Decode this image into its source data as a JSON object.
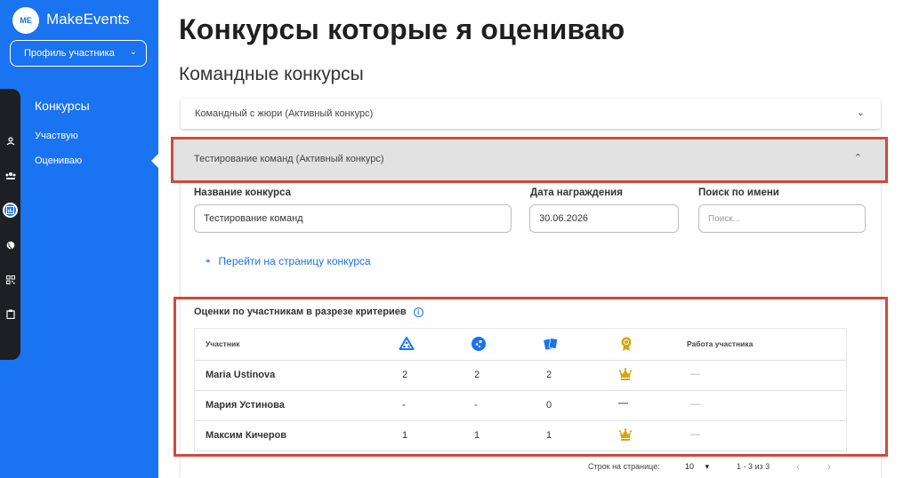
{
  "app": {
    "logo_badge": "ME",
    "logo_text": "MakeEvents"
  },
  "sidebar": {
    "profile_select": "Профиль участника",
    "section": "Конкурсы",
    "items": [
      {
        "label": "Участвую"
      },
      {
        "label": "Оцениваю"
      }
    ]
  },
  "page": {
    "title": "Конкурсы которые я оцениваю",
    "section_title": "Командные конкурсы"
  },
  "accordions": [
    {
      "label": "Командный с жюри (Активный конкурс)",
      "expanded": false
    },
    {
      "label": "Тестирование команд (Активный конкурс)",
      "expanded": true
    }
  ],
  "form": {
    "name_label": "Название конкурса",
    "name_value": "Тестирование команд",
    "date_label": "Дата награждения",
    "date_value": "30.06.2026",
    "search_label": "Поиск по имени",
    "search_placeholder": "Поиск..."
  },
  "link_text": "Перейти на страницу конкурса",
  "scores": {
    "title": "Оценки по участникам в разрезе критериев",
    "col_participant": "Участник",
    "col_work": "Работа участника",
    "rows": [
      {
        "name": "Maria Ustinova",
        "c1": "2",
        "c2": "2",
        "c3": "2",
        "award": "crown",
        "work": "—"
      },
      {
        "name": "Мария Устинова",
        "c1": "-",
        "c2": "-",
        "c3": "0",
        "award": "—",
        "work": "—"
      },
      {
        "name": "Максим Кичеров",
        "c1": "1",
        "c2": "1",
        "c3": "1",
        "award": "crown",
        "work": "—"
      }
    ]
  },
  "pagination": {
    "rows_label": "Строк на странице:",
    "rows_value": "10",
    "range": "1 - 3 из 3"
  },
  "colors": {
    "accent": "#1a73f0",
    "highlight": "#d04a3d",
    "gold": "#d4a514"
  }
}
